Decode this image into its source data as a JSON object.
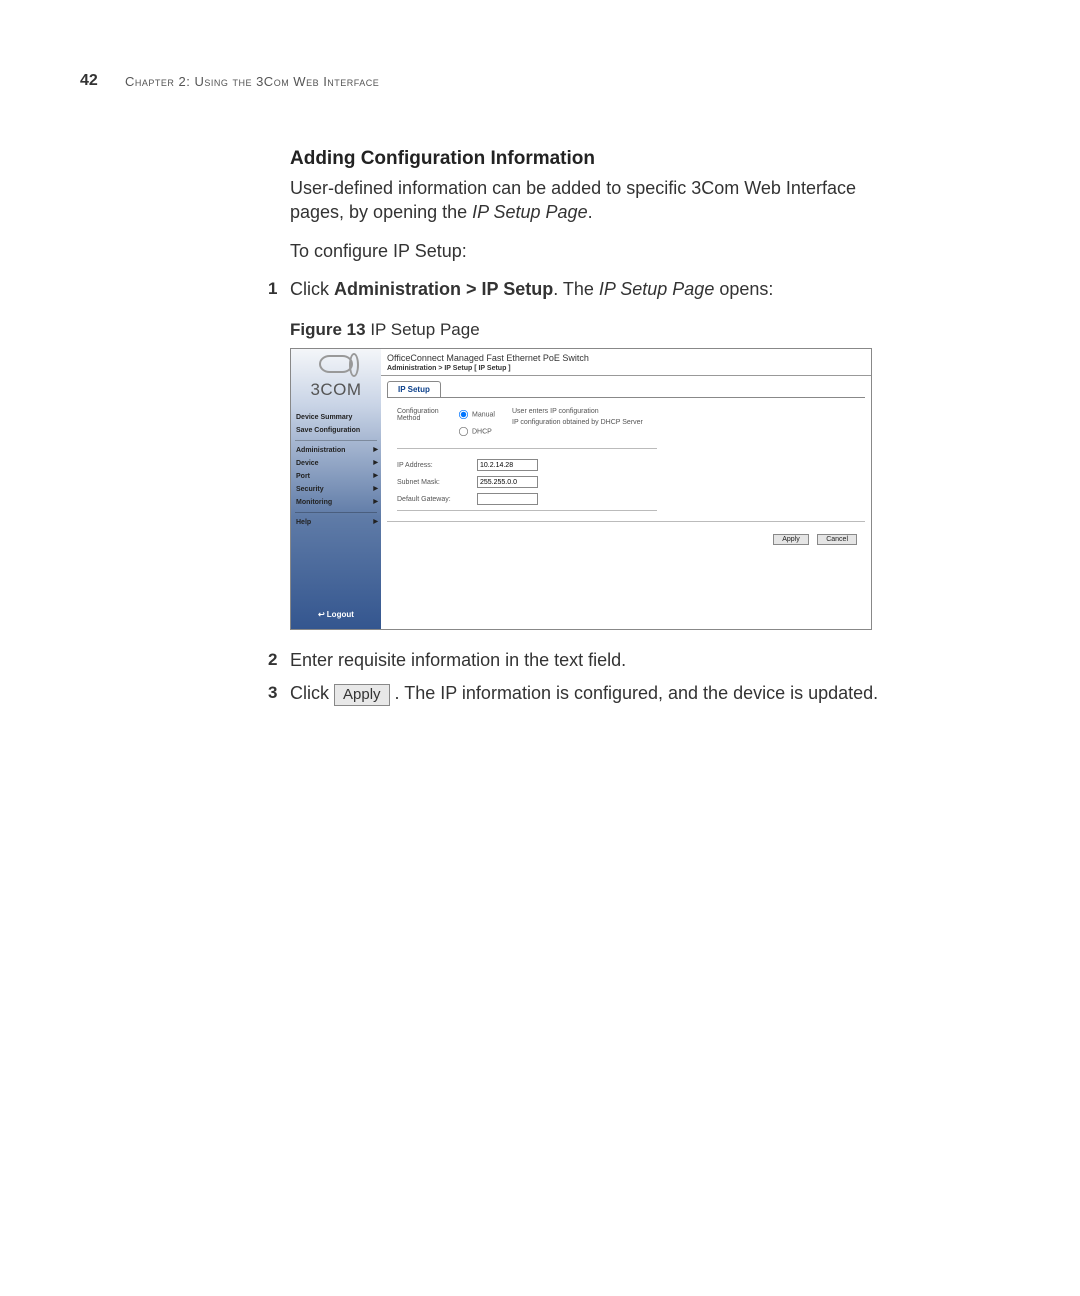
{
  "header": {
    "page_number": "42",
    "chapter": "Chapter 2: Using the 3Com Web Interface"
  },
  "section_title": "Adding Configuration Information",
  "para1_a": "User-defined information can be added to specific 3Com Web Interface pages, by opening the ",
  "para1_b": "IP Setup Page",
  "para1_c": ".",
  "para2": "To configure IP Setup:",
  "step1_a": "Click ",
  "step1_b": "Administration > IP Setup",
  "step1_c": ". The ",
  "step1_d": "IP Setup Page",
  "step1_e": " opens:",
  "figure_label_bold": "Figure 13",
  "figure_label_rest": "   IP Setup Page",
  "screenshot": {
    "brand": "3COM",
    "nav_top1": "Device Summary",
    "nav_top2": "Save Configuration",
    "nav_admin": "Administration",
    "nav_device": "Device",
    "nav_port": "Port",
    "nav_security": "Security",
    "nav_monitoring": "Monitoring",
    "nav_help": "Help",
    "logout": "Logout",
    "title": "OfficeConnect Managed Fast Ethernet PoE Switch",
    "breadcrumb": "Administration > IP Setup [ IP Setup ]",
    "tab": "IP Setup",
    "config_method_label": "Configuration Method",
    "radio_manual": "Manual",
    "radio_dhcp": "DHCP",
    "desc_manual": "User enters IP configuration",
    "desc_dhcp": "IP configuration obtained by DHCP Server",
    "ip_label": "IP Address:",
    "ip_value": "10.2.14.28",
    "mask_label": "Subnet Mask:",
    "mask_value": "255.255.0.0",
    "gw_label": "Default Gateway:",
    "gw_value": "",
    "apply": "Apply",
    "cancel": "Cancel"
  },
  "step2": "Enter requisite information in the text field.",
  "step3_a": "Click ",
  "step3_btn": "Apply",
  "step3_b": " . The IP information is configured, and the device is updated."
}
